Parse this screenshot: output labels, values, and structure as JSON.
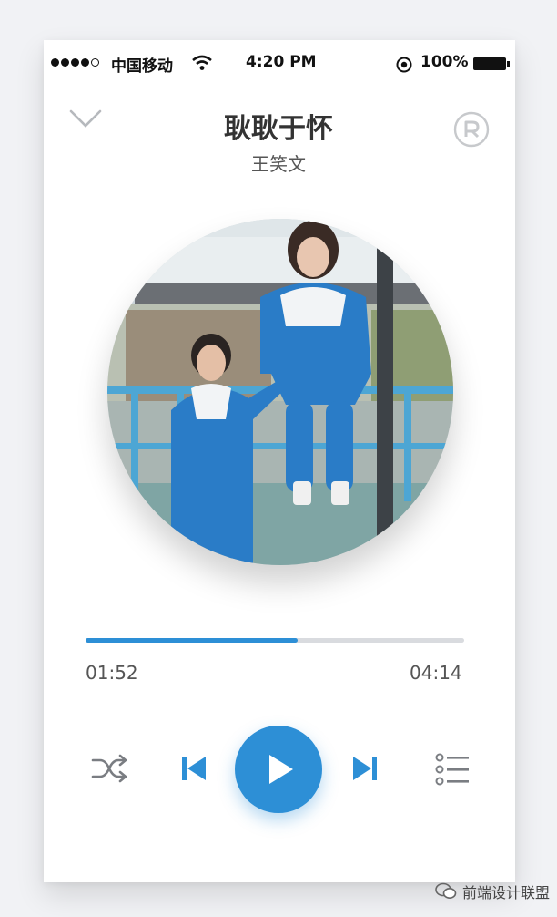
{
  "status_bar": {
    "carrier": "中国移动",
    "time": "4:20 PM",
    "battery": "100%"
  },
  "icons": {
    "collapse": "chevron-down-icon",
    "registered": "registered-icon",
    "shuffle": "shuffle-icon",
    "previous": "skip-previous-icon",
    "play": "play-icon",
    "next": "skip-next-icon",
    "playlist": "playlist-icon",
    "watermark": "wechat-icon"
  },
  "song": {
    "title": "耿耿于怀",
    "artist": "王笑文"
  },
  "player": {
    "current_time": "01:52",
    "total_time": "04:14",
    "progress": 0.56
  },
  "colors": {
    "accent": "#2d8fd6",
    "track": "#d9dbdf"
  },
  "watermark": "前端设计联盟"
}
